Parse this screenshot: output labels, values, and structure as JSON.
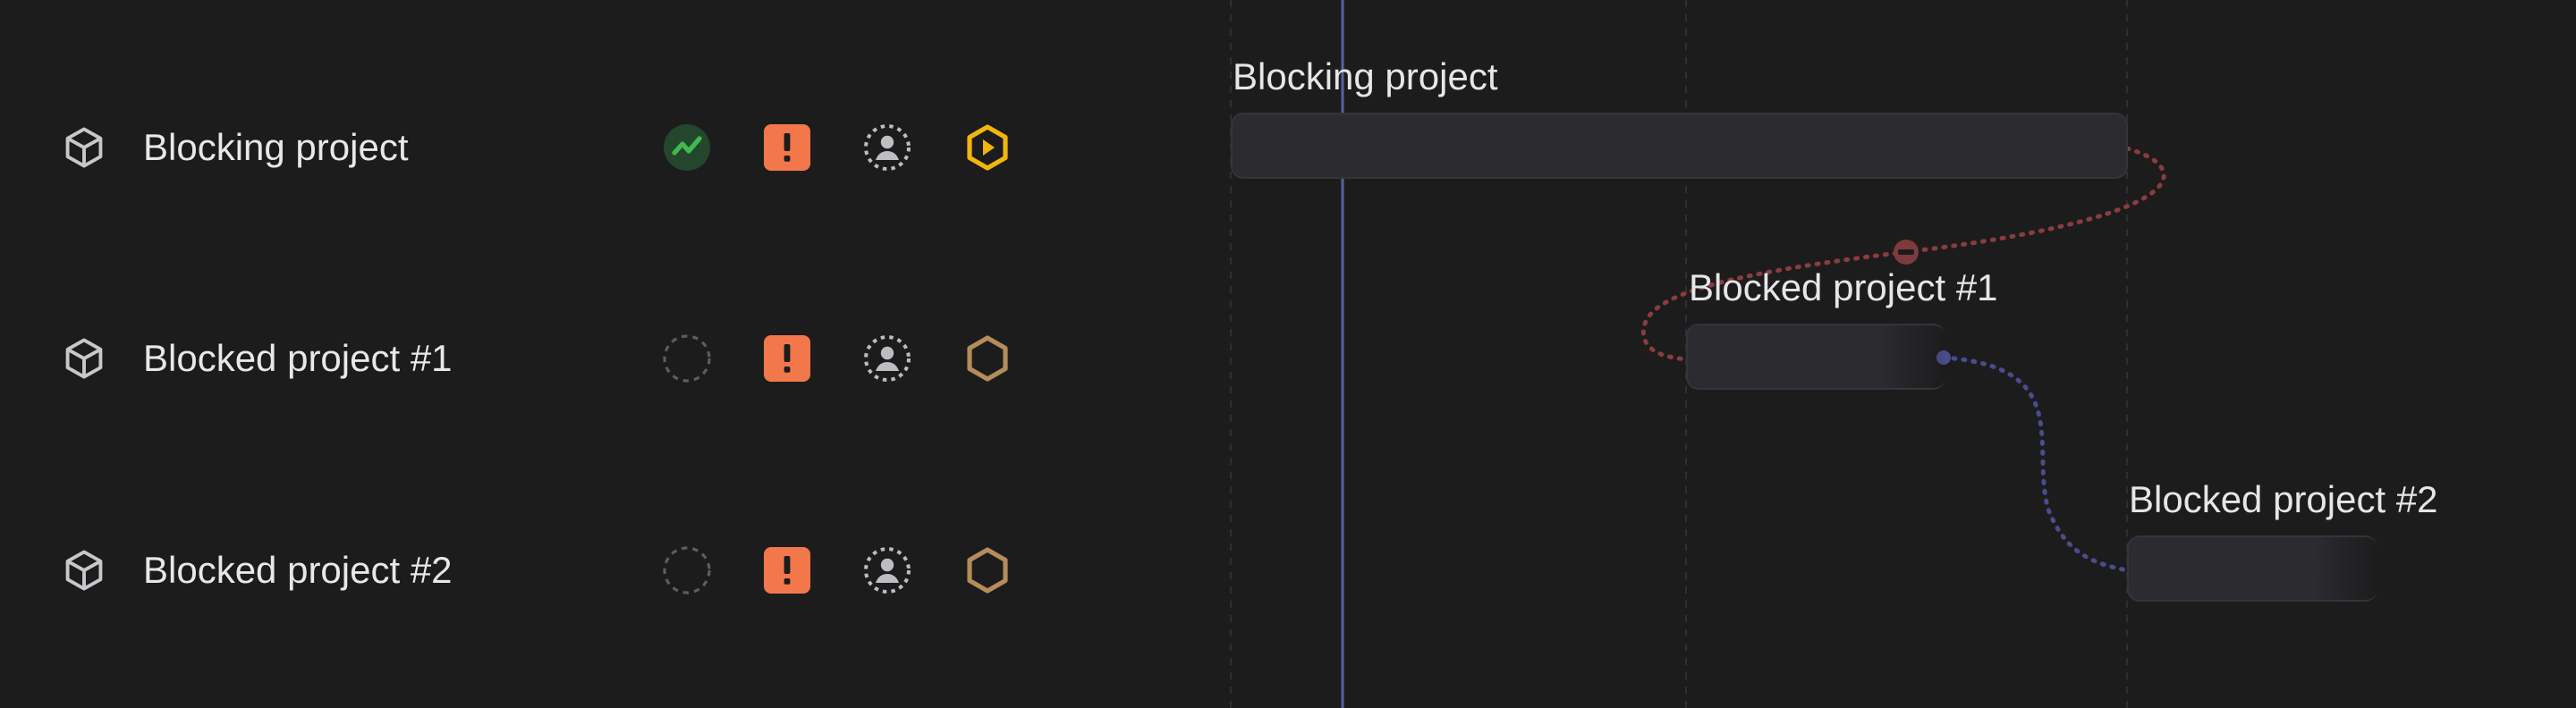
{
  "projects": [
    {
      "name": "Blocking project",
      "health_icon": "health-on-track-icon",
      "priority_icon": "priority-urgent-icon",
      "lead_icon": "lead-unassigned-icon",
      "status_icon": "status-started-icon"
    },
    {
      "name": "Blocked project #1",
      "health_icon": "health-none-icon",
      "priority_icon": "priority-urgent-icon",
      "lead_icon": "lead-unassigned-icon",
      "status_icon": "status-planned-icon"
    },
    {
      "name": "Blocked project #2",
      "health_icon": "health-none-icon",
      "priority_icon": "priority-urgent-icon",
      "lead_icon": "lead-unassigned-icon",
      "status_icon": "status-planned-icon"
    }
  ],
  "timeline": {
    "bars": [
      {
        "label": "Blocking project"
      },
      {
        "label": "Blocked project #1"
      },
      {
        "label": "Blocked project #2"
      }
    ]
  },
  "colors": {
    "background": "#1c1c1d",
    "health_green": "#3fb950",
    "priority_orange": "#f2774a",
    "status_started": "#f1b60c",
    "status_planned": "#b58c5a",
    "today_line": "#5a5fa8",
    "blocking_link": "#8a3c3e",
    "relation_link": "#4a4c8c"
  }
}
